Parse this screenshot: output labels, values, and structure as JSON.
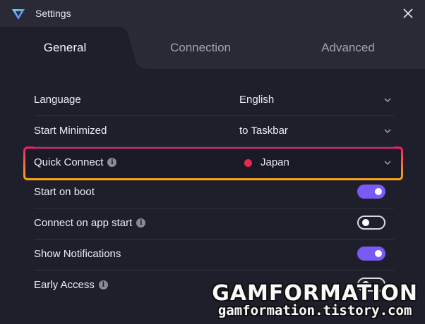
{
  "window": {
    "title": "Settings"
  },
  "tabs": [
    {
      "label": "General",
      "active": true
    },
    {
      "label": "Connection",
      "active": false
    },
    {
      "label": "Advanced",
      "active": false
    }
  ],
  "settings": {
    "language": {
      "label": "Language",
      "value": "English"
    },
    "start_minimized": {
      "label": "Start Minimized",
      "value": "to Taskbar"
    },
    "quick_connect": {
      "label": "Quick Connect",
      "value": "Japan",
      "has_info": true
    },
    "start_on_boot": {
      "label": "Start on boot",
      "enabled": true
    },
    "connect_on_app_start": {
      "label": "Connect on app start",
      "enabled": false,
      "has_info": true
    },
    "show_notifications": {
      "label": "Show Notifications",
      "enabled": true
    },
    "early_access": {
      "label": "Early Access",
      "enabled": false,
      "has_info": true
    }
  },
  "watermark": {
    "title": "GAMFORMATION",
    "subtitle": "gamformation.tistory.com"
  },
  "colors": {
    "accent": "#7a5af5",
    "highlight_gradient": [
      "#f0196a",
      "#f7a51a"
    ],
    "flag_dot": "#e8294f"
  }
}
